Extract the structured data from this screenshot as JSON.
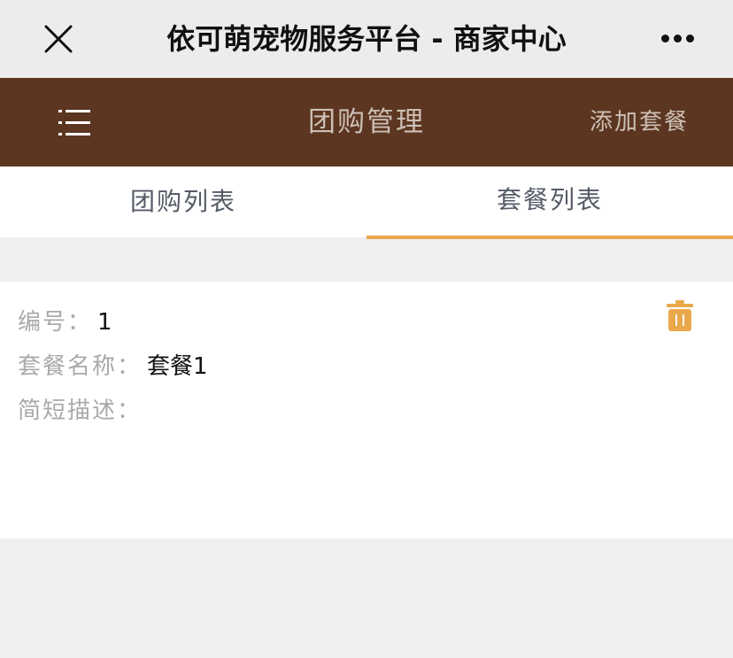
{
  "window": {
    "title": "依可萌宠物服务平台 - 商家中心",
    "close_icon": "close-icon",
    "more_icon": "more-dots-icon"
  },
  "header": {
    "menu_icon": "menu-list-icon",
    "title": "团购管理",
    "action_label": "添加套餐"
  },
  "tabs": [
    {
      "label": "团购列表",
      "active": false
    },
    {
      "label": "套餐列表",
      "active": true
    }
  ],
  "package": {
    "id_label": "编号：",
    "id_value": "1",
    "name_label": "套餐名称：",
    "name_value": "套餐1",
    "desc_label": "简短描述：",
    "desc_value": "",
    "delete_icon": "trash-icon"
  },
  "colors": {
    "header_bg": "#5c3620",
    "accent": "#e9a84a",
    "topbar_bg": "#ececec",
    "page_bg": "#efefef"
  }
}
